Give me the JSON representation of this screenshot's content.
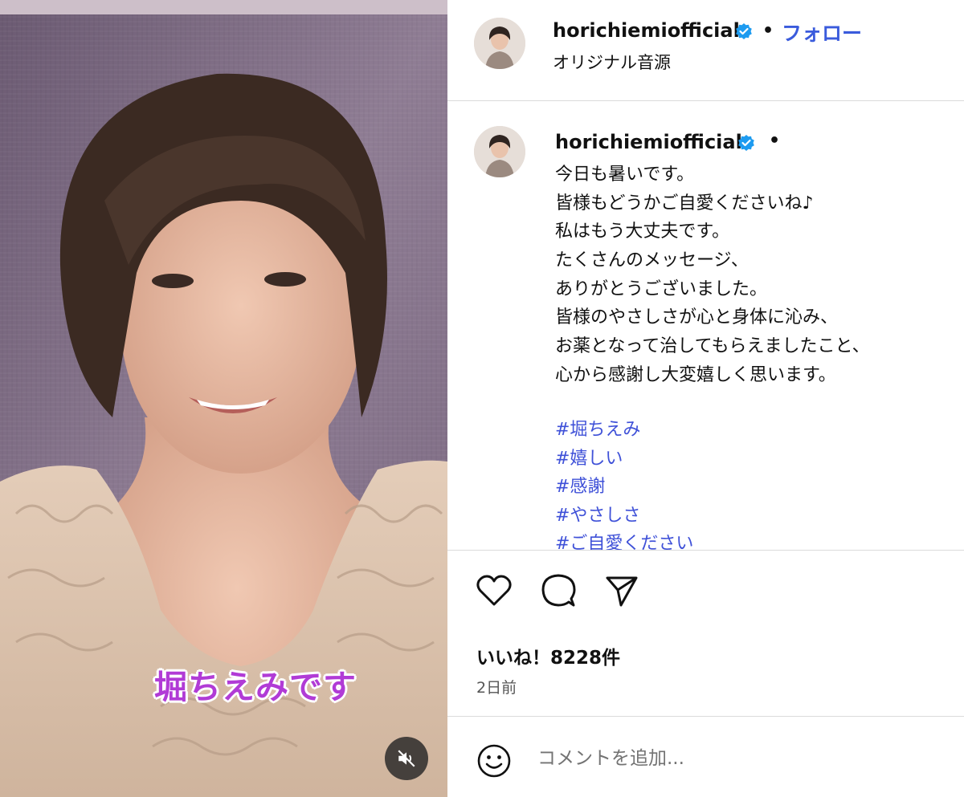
{
  "media": {
    "overlay_caption": "堀ちえみです",
    "mute_icon": "speaker-muted-icon"
  },
  "header": {
    "username": "horichiemiofficial",
    "separator": "•",
    "follow_label": "フォロー",
    "audio_label": "オリジナル音源"
  },
  "post": {
    "username": "horichiemiofficial",
    "separator": "•",
    "caption_lines": [
      "今日も暑いです。",
      "皆様もどうかご自愛くださいね♪",
      "私はもう大丈夫です。",
      "たくさんのメッセージ、",
      "ありがとうございました。",
      "皆様のやさしさが心と身体に沁み、",
      "お薬となって治してもらえましたこと、",
      "心から感謝し大変嬉しく思います。"
    ],
    "hashtags": [
      "#堀ちえみ",
      "#嬉しい",
      "#感謝",
      "#やさしさ",
      "#ご自愛ください"
    ]
  },
  "actions": {
    "icons": [
      "heart-icon",
      "comment-icon",
      "share-icon"
    ],
    "likes": "いいね！8228件",
    "time_ago": "2日前"
  },
  "comment": {
    "placeholder": "コメントを追加...",
    "emoji_icon": "smiley-icon"
  },
  "colors": {
    "link_blue": "#3a5bdc",
    "verified_blue": "#1d9bf0",
    "overlay_text": "#b13bd6"
  }
}
